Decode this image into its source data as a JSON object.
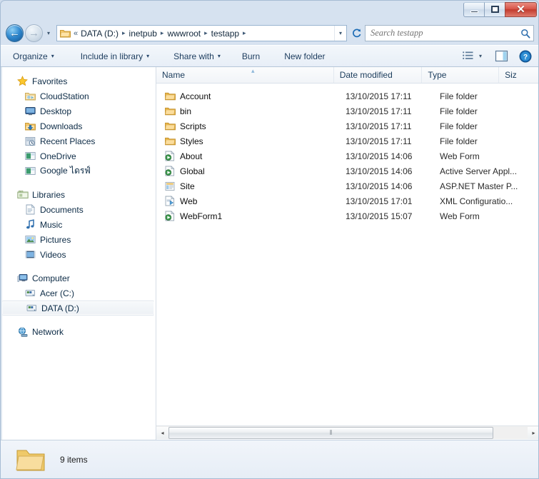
{
  "window": {
    "controls": {
      "minimize_label": "–",
      "maximize_label": "□",
      "close_label": "✕"
    }
  },
  "address_bar": {
    "back_label": "←",
    "forward_label": "→",
    "history_caret": "▾",
    "breadcrumb_prefix": "«",
    "breadcrumb": [
      "DATA (D:)",
      "inetpub",
      "wwwroot",
      "testapp"
    ],
    "breadcrumb_separator": "▸",
    "dropdown_caret": "▾",
    "refresh_label": "↻"
  },
  "search": {
    "placeholder": "Search testapp",
    "value": "",
    "icon": "search-icon"
  },
  "toolbar": {
    "items": [
      {
        "label": "Organize",
        "caret": "▾"
      },
      {
        "label": "Include in library",
        "caret": "▾"
      },
      {
        "label": "Share with",
        "caret": "▾"
      },
      {
        "label": "Burn",
        "caret": ""
      },
      {
        "label": "New folder",
        "caret": ""
      }
    ],
    "view_caret": "▾"
  },
  "sidebar": {
    "groups": [
      {
        "name": "favorites",
        "header": {
          "label": "Favorites",
          "icon": "star-icon"
        },
        "items": [
          {
            "label": "CloudStation",
            "icon": "cloudstation-folder-icon"
          },
          {
            "label": "Desktop",
            "icon": "desktop-monitor-icon"
          },
          {
            "label": "Downloads",
            "icon": "downloads-folder-icon"
          },
          {
            "label": "Recent Places",
            "icon": "recent-places-icon"
          },
          {
            "label": "OneDrive",
            "icon": "onedrive-icon"
          },
          {
            "label": "Google ไดรฟ์",
            "icon": "google-drive-icon"
          }
        ]
      },
      {
        "name": "libraries",
        "header": {
          "label": "Libraries",
          "icon": "libraries-icon"
        },
        "items": [
          {
            "label": "Documents",
            "icon": "documents-icon"
          },
          {
            "label": "Music",
            "icon": "music-note-icon"
          },
          {
            "label": "Pictures",
            "icon": "pictures-icon"
          },
          {
            "label": "Videos",
            "icon": "videos-icon"
          }
        ]
      },
      {
        "name": "computer",
        "header": {
          "label": "Computer",
          "icon": "computer-icon"
        },
        "items": [
          {
            "label": "Acer (C:)",
            "icon": "hard-drive-icon",
            "selected": false
          },
          {
            "label": "DATA (D:)",
            "icon": "hard-drive-icon",
            "selected": true
          }
        ]
      },
      {
        "name": "network",
        "header": {
          "label": "Network",
          "icon": "network-icon"
        },
        "items": []
      }
    ]
  },
  "file_list": {
    "columns": [
      {
        "key": "name",
        "label": "Name",
        "sorted": "asc"
      },
      {
        "key": "date",
        "label": "Date modified",
        "sorted": ""
      },
      {
        "key": "type",
        "label": "Type",
        "sorted": ""
      },
      {
        "key": "size",
        "label": "Siz",
        "sorted": ""
      }
    ],
    "sort_arrow": "▴",
    "rows": [
      {
        "name": "Account",
        "date": "13/10/2015 17:11",
        "type": "File folder",
        "size": "",
        "icon": "folder-icon"
      },
      {
        "name": "bin",
        "date": "13/10/2015 17:11",
        "type": "File folder",
        "size": "",
        "icon": "folder-icon"
      },
      {
        "name": "Scripts",
        "date": "13/10/2015 17:11",
        "type": "File folder",
        "size": "",
        "icon": "folder-icon"
      },
      {
        "name": "Styles",
        "date": "13/10/2015 17:11",
        "type": "File folder",
        "size": "",
        "icon": "folder-icon"
      },
      {
        "name": "About",
        "date": "13/10/2015 14:06",
        "type": "Web Form",
        "size": "",
        "icon": "aspx-web-form-icon"
      },
      {
        "name": "Global",
        "date": "13/10/2015 14:06",
        "type": "Active Server Appl...",
        "size": "",
        "icon": "aspx-web-form-icon"
      },
      {
        "name": "Site",
        "date": "13/10/2015 14:06",
        "type": "ASP.NET Master P...",
        "size": "",
        "icon": "master-page-icon"
      },
      {
        "name": "Web",
        "date": "13/10/2015 17:01",
        "type": "XML Configuratio...",
        "size": "",
        "icon": "xml-config-icon"
      },
      {
        "name": "WebForm1",
        "date": "13/10/2015 15:07",
        "type": "Web Form",
        "size": "",
        "icon": "aspx-web-form-icon"
      }
    ]
  },
  "scrollbar": {
    "left_arrow": "◂",
    "right_arrow": "▸",
    "grip": "⦀"
  },
  "status_bar": {
    "item_count": "9 items",
    "icon": "large-folder-icon"
  },
  "colors": {
    "folder_yellow": "#f7d086",
    "accent_blue": "#2f88cf",
    "close_red": "#c23b2e",
    "selection": "#f2f5f8"
  }
}
